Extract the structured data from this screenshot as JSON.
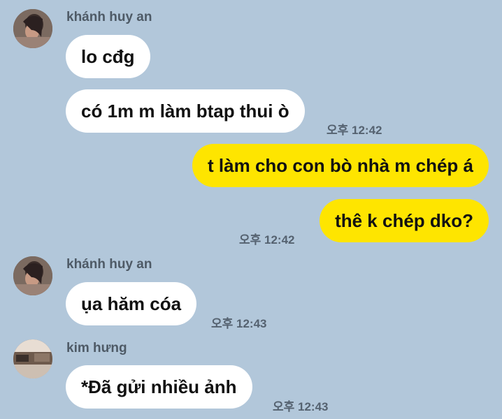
{
  "messages": [
    {
      "group": "khanh-1",
      "sender": "khánh huy an",
      "bubbles": [
        "lo cđg",
        "có 1m m làm btap thui ò"
      ],
      "time": "오후 12:42"
    },
    {
      "group": "me-1",
      "bubbles": [
        "t làm cho con bò nhà m chép á",
        "thê k chép dko?"
      ],
      "time": "오후 12:42"
    },
    {
      "group": "khanh-2",
      "sender": "khánh huy an",
      "bubbles": [
        "ụa hăm cóa"
      ],
      "time": "오후 12:43"
    },
    {
      "group": "kim-1",
      "sender": "kim hưng",
      "bubbles": [
        "*Đã gửi nhiều ảnh"
      ],
      "time": "오후 12:43"
    }
  ],
  "colors": {
    "background": "#b2c7da",
    "incoming_bubble": "#ffffff",
    "outgoing_bubble": "#fee500"
  },
  "icons": [
    "profile-avatar",
    "profile-avatar",
    "profile-avatar"
  ]
}
